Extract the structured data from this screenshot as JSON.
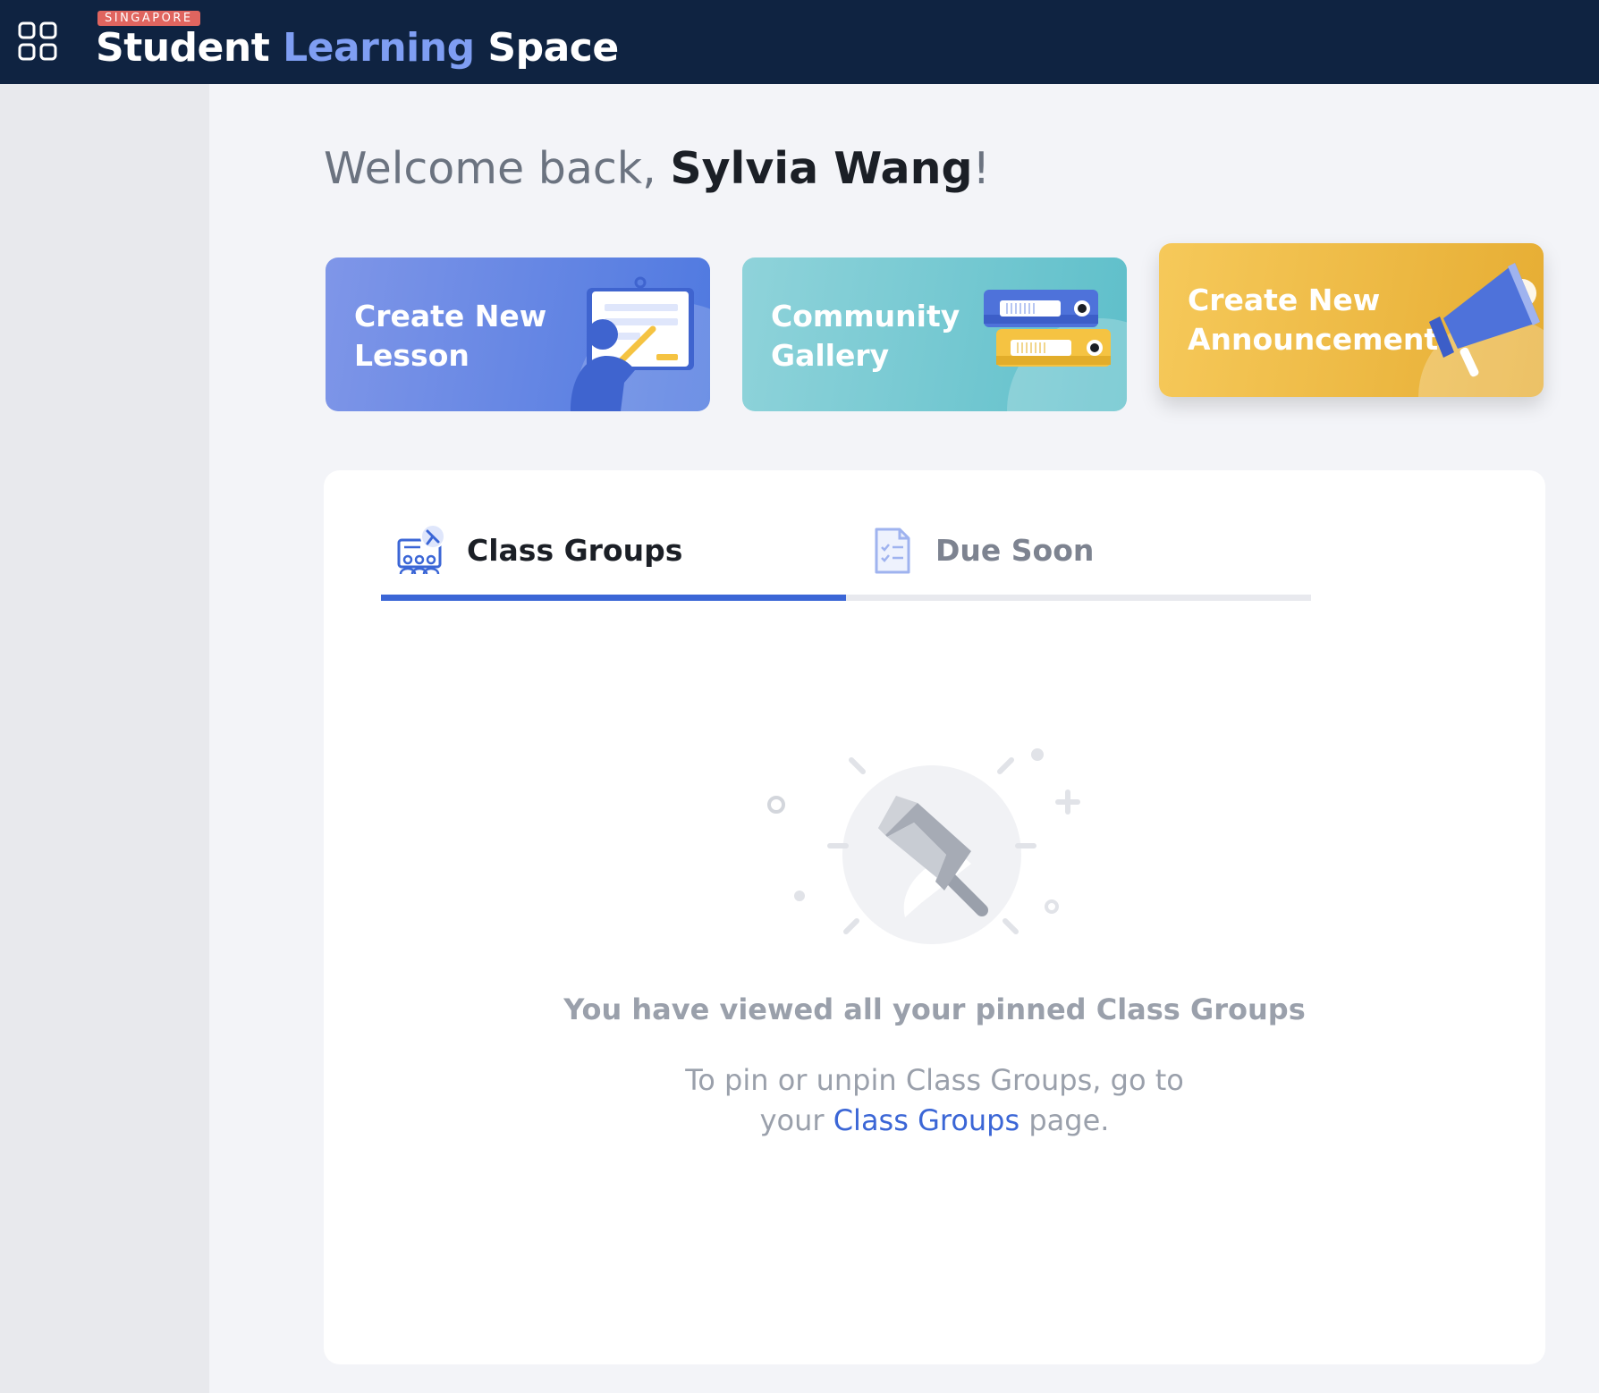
{
  "header": {
    "country_tag": "SINGAPORE",
    "brand_part1": "Student",
    "brand_part2": "Learning",
    "brand_part3": "Space",
    "apps_icon": "grid-icon",
    "background": "#0f2341"
  },
  "welcome": {
    "greeting": "Welcome back, ",
    "user_name": "Sylvia Wang",
    "punctuation": "!"
  },
  "cards": [
    {
      "label": "Create New Lesson",
      "icon": "teacher-whiteboard-icon",
      "color": "#5a7fe2"
    },
    {
      "label": "Community Gallery",
      "icon": "binders-icon",
      "color": "#6ec6cf"
    },
    {
      "label": "Create New Announcement",
      "icon": "megaphone-icon",
      "color": "#f0b940"
    }
  ],
  "tabs": [
    {
      "label": "Class Groups",
      "icon": "class-groups-icon",
      "active": true
    },
    {
      "label": "Due Soon",
      "icon": "checklist-document-icon",
      "active": false
    }
  ],
  "empty_state": {
    "icon": "pin-icon",
    "title": "You have viewed all your pinned Class Groups",
    "desc_before": "To pin or unpin Class Groups, go to your ",
    "desc_link": "Class Groups",
    "desc_after": " page."
  },
  "colors": {
    "accent": "#3b66d6",
    "page_bg": "#f3f4f8",
    "sidebar_bg": "#e8e9ed"
  }
}
